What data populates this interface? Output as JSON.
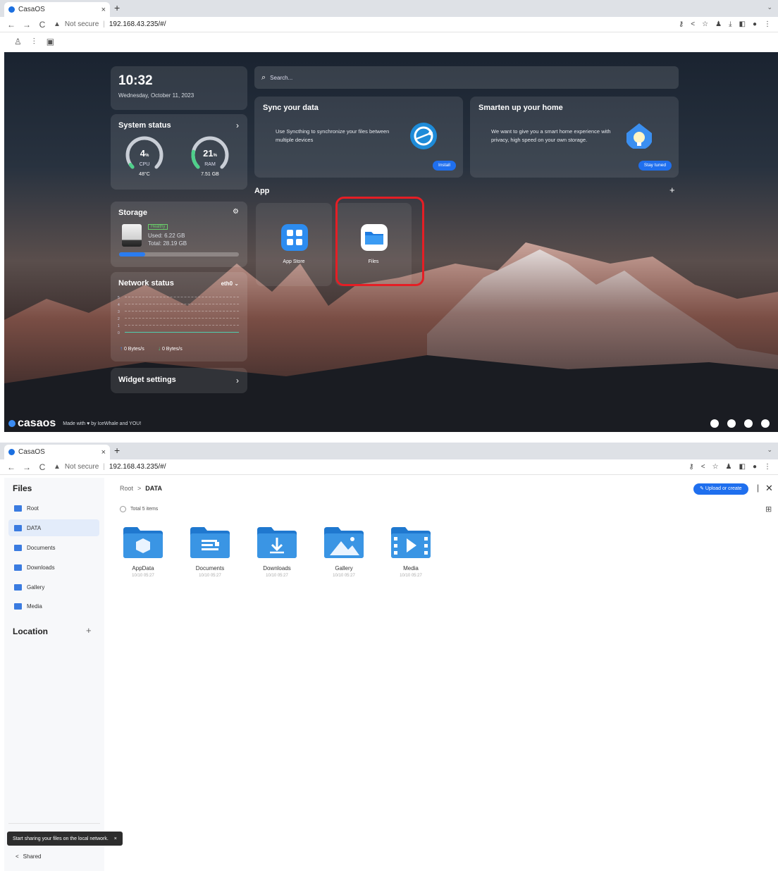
{
  "browser_top": {
    "tab_title": "CasaOS",
    "tab_close": "×",
    "new_tab": "+",
    "not_secure": "Not secure",
    "url": "192.168.43.235/#/"
  },
  "dashboard": {
    "time": "10:32",
    "date": "Wednesday, October 11, 2023",
    "search_placeholder": "Search...",
    "system_status": {
      "title": "System status",
      "cpu_percent": 4,
      "cpu_value": "4",
      "cpu_label": "CPU",
      "cpu_temp": "48°C",
      "ram_percent": 21,
      "ram_value": "21",
      "ram_label": "RAM",
      "ram_size": "7.51 GB",
      "percent_sign": "%"
    },
    "storage": {
      "title": "Storage",
      "health": "Healthy",
      "used": "Used: 6.22 GB",
      "total": "Total: 28.19 GB",
      "used_fraction": 0.22
    },
    "network": {
      "title": "Network status",
      "interface": "eth0",
      "y_ticks": [
        "5",
        "4",
        "3",
        "2",
        "1",
        "0"
      ],
      "upload_rate": "0 Bytes/s",
      "download_rate": "0 Bytes/s"
    },
    "widget_settings": "Widget settings",
    "sync": {
      "title": "Sync your data",
      "text": "Use Syncthing to synchronize your files between multiple devices",
      "button": "Install"
    },
    "smart": {
      "title": "Smarten up your home",
      "text": "We want to give you a smart home experience with privacy, high speed on your own storage.",
      "button": "Stay tuned"
    },
    "app_section": "App",
    "apps": [
      {
        "label": "App Store"
      },
      {
        "label": "Files"
      }
    ],
    "footer_logo": "casaos",
    "footer_made": "Made with ♥ by IceWhale and YOU!"
  },
  "browser_bottom": {
    "tab_title": "CasaOS",
    "tab_close": "×",
    "new_tab": "+",
    "not_secure": "Not secure",
    "url": "192.168.43.235/#/"
  },
  "files": {
    "title": "Files",
    "sidebar": [
      "Root",
      "DATA",
      "Documents",
      "Downloads",
      "Gallery",
      "Media"
    ],
    "location": "Location",
    "breadcrumb": [
      "Root",
      "DATA"
    ],
    "breadcrumb_sep": ">",
    "total_items": "Total 5 items",
    "upload_button": "Upload or create",
    "folders": [
      {
        "name": "AppData",
        "date": "10/10 05:27",
        "icon": "cube-icon"
      },
      {
        "name": "Documents",
        "date": "10/10 05:27",
        "icon": "document-icon"
      },
      {
        "name": "Downloads",
        "date": "10/10 05:27",
        "icon": "download-icon"
      },
      {
        "name": "Gallery",
        "date": "10/10 05:27",
        "icon": "image-icon"
      },
      {
        "name": "Media",
        "date": "10/10 05:27",
        "icon": "video-icon"
      }
    ],
    "tooltip": "Start sharing your files on the local network.",
    "shared": "Shared"
  },
  "colors": {
    "accent": "#1f6fee",
    "highlight": "#e51e25",
    "folder": "#2f86d6"
  }
}
